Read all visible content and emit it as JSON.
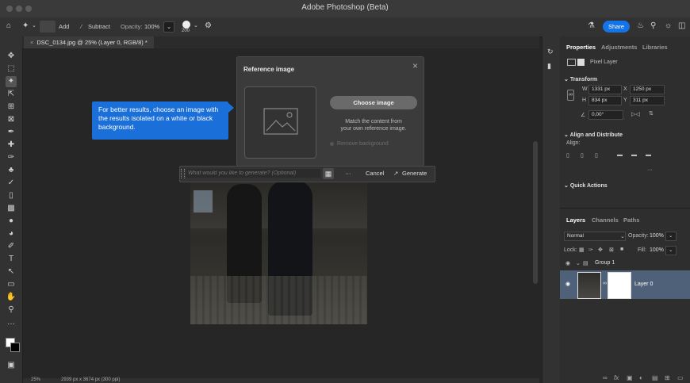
{
  "app_title": "Adobe Photoshop (Beta)",
  "options_bar": {
    "add_label": "Add",
    "subtract_label": "Subtract",
    "opacity_label": "Opacity:",
    "opacity_value": "100%",
    "brush_size": "200",
    "share_label": "Share"
  },
  "document_tab": {
    "label": "DSC_0134.jpg @ 25% (Layer 0, RGB/8) *"
  },
  "reference_panel": {
    "title": "Reference image",
    "choose_button": "Choose image",
    "match_text_line1": "Match the content from",
    "match_text_line2": "your own reference image.",
    "remove_background": "Remove background"
  },
  "prompt_bar": {
    "placeholder": "What would you like to generate? (Optional)",
    "more_label": "···",
    "cancel_label": "Cancel",
    "generate_label": "Generate"
  },
  "tooltip": {
    "text": "For better results, choose an image with the results isolated on a white or black background."
  },
  "status_bar": {
    "zoom": "25%",
    "dimensions": "2939 px x 3674 px (300 ppi)"
  },
  "properties_panel": {
    "tabs": [
      "Properties",
      "Adjustments",
      "Libraries"
    ],
    "layer_kind": "Pixel Layer",
    "transform_label": "Transform",
    "w_label": "W",
    "w_value": "1331 px",
    "x_label": "X",
    "x_value": "1250 px",
    "h_label": "H",
    "h_value": "834 px",
    "y_label": "Y",
    "y_value": "311 px",
    "angle_value": "0,00°",
    "align_label": "Align and Distribute",
    "align_sub": "Align:",
    "more_dots": "···",
    "quick_actions_label": "Quick Actions"
  },
  "layers_panel": {
    "tabs": [
      "Layers",
      "Channels",
      "Paths"
    ],
    "blend_mode": "Normal",
    "opacity_label": "Opacity:",
    "opacity_value": "100%",
    "lock_label": "Lock:",
    "fill_label": "Fill:",
    "fill_value": "100%",
    "group_name": "Group 1",
    "layer_name": "Layer 0"
  },
  "colors": {
    "accent": "#1473e6",
    "tooltip_bg": "#1b6fd8",
    "selected_layer": "#4f6178"
  }
}
